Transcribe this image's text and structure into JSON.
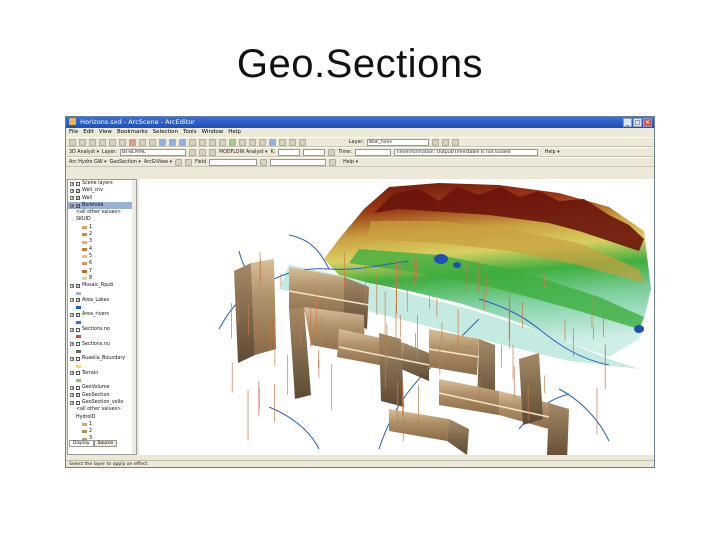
{
  "slide": {
    "title": "Geo.Sections"
  },
  "window": {
    "title": "Horizons.sxd - ArcScene - ArcEditor",
    "buttons": {
      "minimize": "_",
      "maximize": "□",
      "close": "×"
    }
  },
  "menu": [
    "File",
    "Edit",
    "View",
    "Bookmarks",
    "Selection",
    "Tools",
    "Window",
    "Help"
  ],
  "toolbar2": {
    "layer_combo": "Wall_hires",
    "analyst": "3D Analyst ▾",
    "layer": "Layer:",
    "layer_value": "Bs-BLAYAL",
    "modflow": "MODFLOW Analyst ▾",
    "k_label": "K:",
    "time_label": "Time:",
    "info": "TimeInformation: Output/Timestable Is not loaded",
    "help": "Help ▾"
  },
  "toolbar3": {
    "arc_tools": "Arc Hydro GW ▾",
    "geosection": "GeoSection ▾",
    "arc_view": "ArcGiView ▾",
    "field": "Field"
  },
  "toc": {
    "layers": [
      {
        "label": "Scene layers",
        "check": false,
        "indent": 0,
        "swatch": ""
      },
      {
        "label": "Well_cnv",
        "check": true,
        "indent": 0,
        "swatch": ""
      },
      {
        "label": "Well",
        "check": true,
        "indent": 0,
        "swatch": ""
      },
      {
        "label": "Borehole",
        "check": true,
        "indent": 0,
        "swatch": "",
        "selected": true
      },
      {
        "label": "<all other values>",
        "check": false,
        "indent": 1,
        "swatch": ""
      },
      {
        "label": "SKUID",
        "check": false,
        "indent": 1,
        "swatch": ""
      },
      {
        "label": "1",
        "check": false,
        "indent": 2,
        "swatch": "#e0a060"
      },
      {
        "label": "2",
        "check": false,
        "indent": 2,
        "swatch": "#d08a4a"
      },
      {
        "label": "3",
        "check": false,
        "indent": 2,
        "swatch": "#e6b070"
      },
      {
        "label": "4",
        "check": false,
        "indent": 2,
        "swatch": "#c27a3a"
      },
      {
        "label": "5",
        "check": false,
        "indent": 2,
        "swatch": "#eec088"
      },
      {
        "label": "6",
        "check": false,
        "indent": 2,
        "swatch": "#d49458"
      },
      {
        "label": "7",
        "check": false,
        "indent": 2,
        "swatch": "#b86c30"
      },
      {
        "label": "8",
        "check": false,
        "indent": 2,
        "swatch": "#f0caa0"
      },
      {
        "label": "Mosaic_Rpub",
        "check": true,
        "indent": 0,
        "swatch": ""
      },
      {
        "label": "",
        "check": false,
        "indent": 1,
        "swatch": "#9db4d8"
      },
      {
        "label": "Area_Lakes",
        "check": true,
        "indent": 0,
        "swatch": ""
      },
      {
        "label": "",
        "check": false,
        "indent": 1,
        "swatch": "#1f5fbf"
      },
      {
        "label": "Area_rivers",
        "check": true,
        "indent": 0,
        "swatch": ""
      },
      {
        "label": "",
        "check": false,
        "indent": 1,
        "swatch": "#3a6fd8"
      },
      {
        "label": "Sections.no",
        "check": false,
        "indent": 0,
        "swatch": ""
      },
      {
        "label": "",
        "check": false,
        "indent": 1,
        "swatch": "#d04a4a"
      },
      {
        "label": "Sections.nu",
        "check": false,
        "indent": 0,
        "swatch": ""
      },
      {
        "label": "",
        "check": false,
        "indent": 1,
        "swatch": "#666"
      },
      {
        "label": "Ruaelia_Boundary",
        "check": false,
        "indent": 0,
        "swatch": ""
      },
      {
        "label": "",
        "check": false,
        "indent": 1,
        "swatch": "#ffd84a"
      },
      {
        "label": "Terrain",
        "check": false,
        "indent": 0,
        "swatch": ""
      },
      {
        "label": "",
        "check": false,
        "indent": 1,
        "swatch": "#7fce5a"
      },
      {
        "label": "GeoVolume",
        "check": false,
        "indent": 0,
        "swatch": ""
      },
      {
        "label": "GeoSection",
        "check": true,
        "indent": 0,
        "swatch": ""
      },
      {
        "label": "GeoSection_vollo",
        "check": false,
        "indent": 0,
        "swatch": ""
      },
      {
        "label": "<all other values>",
        "check": false,
        "indent": 1,
        "swatch": ""
      },
      {
        "label": "HydroID",
        "check": false,
        "indent": 1,
        "swatch": ""
      },
      {
        "label": "1",
        "check": false,
        "indent": 2,
        "swatch": "#d7a868"
      },
      {
        "label": "2",
        "check": false,
        "indent": 2,
        "swatch": "#b8895a"
      },
      {
        "label": "3",
        "check": false,
        "indent": 2,
        "swatch": "#c69a62"
      }
    ],
    "tabs": [
      "Display",
      "Source"
    ]
  },
  "status": "Select the layer to apply an effect",
  "colors": {
    "terrain_high": "#7a1a10",
    "terrain_mid": "#c9a040",
    "terrain_low": "#3fae3f",
    "water": "#2b5fbf",
    "section_fill": "#a88a62"
  }
}
